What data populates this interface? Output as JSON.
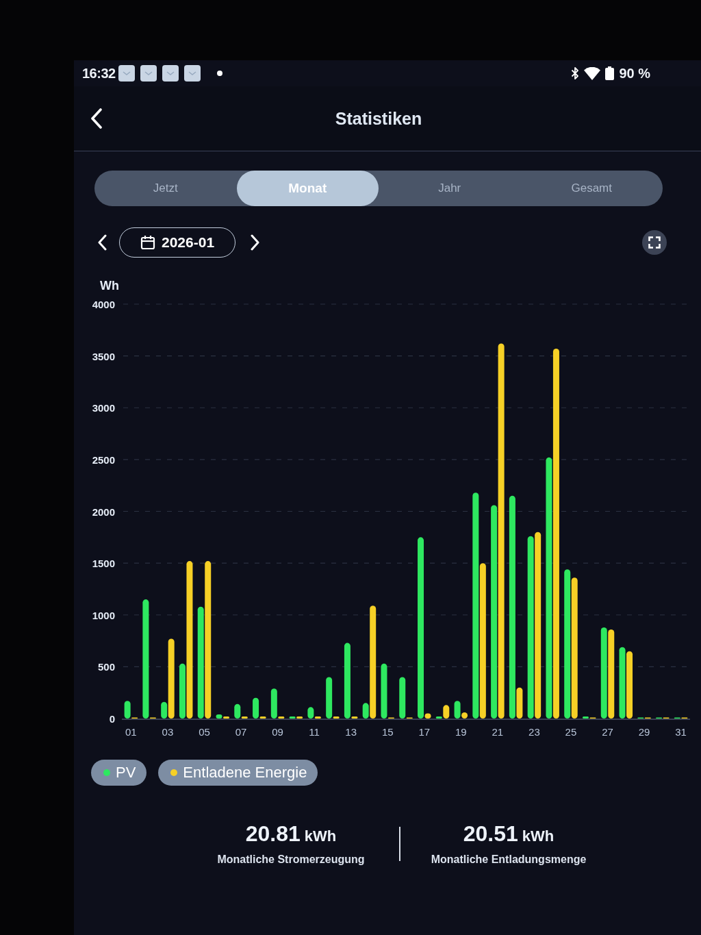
{
  "status_bar": {
    "time": "16:32",
    "battery": "90 %"
  },
  "header": {
    "title": "Statistiken"
  },
  "tabs": [
    {
      "label": "Jetzt",
      "selected": false
    },
    {
      "label": "Monat",
      "selected": true
    },
    {
      "label": "Jahr",
      "selected": false
    },
    {
      "label": "Gesamt",
      "selected": false
    }
  ],
  "period": {
    "value": "2026-01"
  },
  "chart": {
    "chart_data": {
      "type": "bar",
      "ylabel": "Wh",
      "x": [
        1,
        2,
        3,
        4,
        5,
        6,
        7,
        8,
        9,
        10,
        11,
        12,
        13,
        14,
        15,
        16,
        17,
        18,
        19,
        20,
        21,
        22,
        23,
        24,
        25,
        26,
        27,
        28,
        29,
        30,
        31
      ],
      "series": [
        {
          "name": "PV",
          "color": "#2ee860",
          "values": [
            170,
            1150,
            160,
            530,
            1080,
            40,
            140,
            200,
            290,
            20,
            110,
            400,
            730,
            150,
            530,
            400,
            1750,
            20,
            170,
            2180,
            2060,
            2150,
            1760,
            2520,
            1440,
            20,
            880,
            690,
            10,
            10,
            10
          ]
        },
        {
          "name": "Entladene Energie",
          "color": "#f6d026",
          "values": [
            10,
            10,
            770,
            1520,
            1520,
            20,
            20,
            20,
            20,
            20,
            20,
            20,
            20,
            1090,
            10,
            10,
            50,
            130,
            60,
            1500,
            3620,
            300,
            1800,
            3570,
            1360,
            10,
            860,
            650,
            10,
            10,
            10
          ]
        }
      ],
      "xlim": [
        0.5,
        31.5
      ],
      "ylim": [
        0,
        4000
      ],
      "yticks": [
        0,
        500,
        1000,
        1500,
        2000,
        2500,
        3000,
        3500,
        4000
      ],
      "xticks": [
        {
          "value": 1,
          "label": "01"
        },
        {
          "value": 3,
          "label": "03"
        },
        {
          "value": 5,
          "label": "05"
        },
        {
          "value": 7,
          "label": "07"
        },
        {
          "value": 9,
          "label": "09"
        },
        {
          "value": 11,
          "label": "11"
        },
        {
          "value": 13,
          "label": "13"
        },
        {
          "value": 15,
          "label": "15"
        },
        {
          "value": 17,
          "label": "17"
        },
        {
          "value": 19,
          "label": "19"
        },
        {
          "value": 21,
          "label": "21"
        },
        {
          "value": 23,
          "label": "23"
        },
        {
          "value": 25,
          "label": "25"
        },
        {
          "value": 27,
          "label": "27"
        },
        {
          "value": 29,
          "label": "29"
        },
        {
          "value": 31,
          "label": "31"
        }
      ],
      "grid": true
    }
  },
  "stats": [
    {
      "value": "20.81",
      "unit": "kWh",
      "label": "Monatliche Stromerzeugung"
    },
    {
      "value": "20.51",
      "unit": "kWh",
      "label": "Monatliche Entladungsmenge"
    }
  ]
}
